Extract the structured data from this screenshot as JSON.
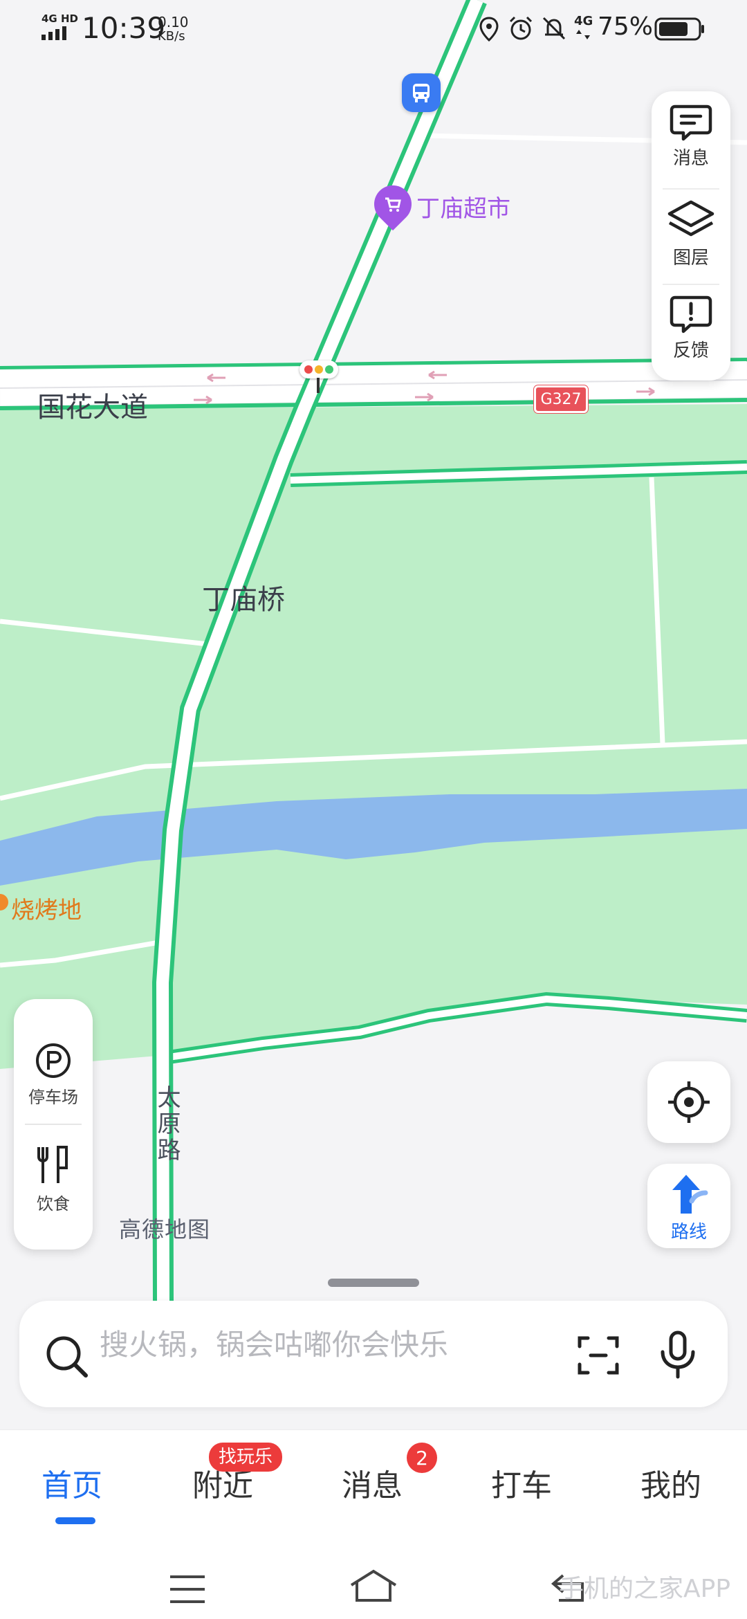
{
  "status_bar": {
    "network_type": "4G HD",
    "time": "10:39",
    "speed_value": "0.10",
    "speed_unit": "KB/s",
    "data_type": "4G",
    "battery_percent": "75%",
    "battery_level": 0.75
  },
  "map": {
    "road_main": "国花大道",
    "bridge": "丁庙桥",
    "road_vertical": "太原路",
    "highway_shield": "G327",
    "poi_supermarket": "丁庙超市",
    "poi_bbq": "烧烤地",
    "logo_text": "高德地图",
    "colors": {
      "park": "#bdeec8",
      "river": "#8cb8ec",
      "road_outline": "#2cc47a",
      "poi_purple": "#a155e6",
      "poi_orange": "#f08a2c"
    }
  },
  "controls": {
    "messages": "消息",
    "layers": "图层",
    "feedback": "反馈",
    "parking": "停车场",
    "food": "饮食",
    "route": "路线"
  },
  "search": {
    "placeholder": "搜火锅，锅会咕嘟你会快乐"
  },
  "tabs": {
    "home": "首页",
    "nearby": "附近",
    "nearby_badge": "找玩乐",
    "messages": "消息",
    "messages_badge": "2",
    "taxi": "打车",
    "mine": "我的"
  },
  "watermark": "手机的之家APP",
  "icons": [
    "signal-icon",
    "location-icon",
    "alarm-icon",
    "bell-off-icon",
    "battery-icon",
    "message-icon",
    "layers-icon",
    "feedback-icon",
    "bus-stop-icon",
    "cart-icon",
    "traffic-light-icon",
    "parking-icon",
    "utensils-icon",
    "locate-icon",
    "route-arrow-icon",
    "search-icon",
    "scan-icon",
    "mic-icon",
    "menu-icon",
    "home-icon",
    "back-icon"
  ]
}
